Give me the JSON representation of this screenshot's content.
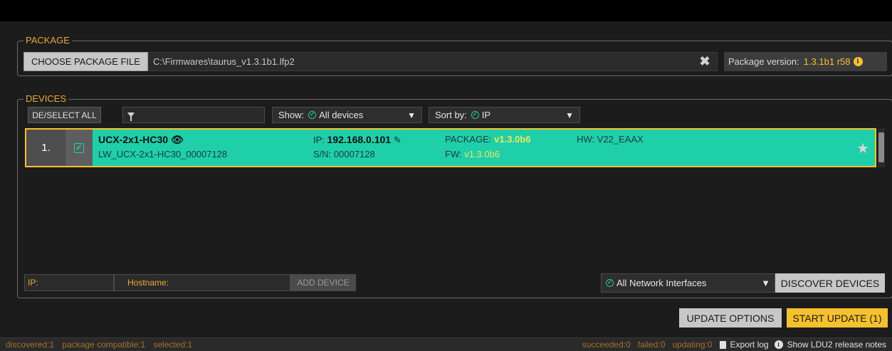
{
  "package": {
    "legend": "PACKAGE",
    "choose_label": "CHOOSE PACKAGE FILE",
    "path_value": "C:\\Firmwares\\taurus_v1.3.1b1.lfp2",
    "clear_icon": "close-icon",
    "version_label": "Package version:",
    "version_value": "1.3.1b1 r58",
    "info_icon": "info-icon"
  },
  "devices": {
    "legend": "DEVICES",
    "deselect_label": "DE/SELECT ALL",
    "filter_icon": "filter-icon",
    "filter_value": "",
    "show_label": "Show:",
    "show_value": "All devices",
    "sort_label": "Sort by:",
    "sort_value": "IP",
    "rows": [
      {
        "index": "1.",
        "name": "UCX-2x1-HC30",
        "hostname": "LW_UCX-2x1-HC30_00007128",
        "ip_label": "IP:",
        "ip_value": "192.168.0.101",
        "sn": "S/N: 00007128",
        "package_label": "PACKAGE:",
        "package_value": "v1.3.0b6",
        "fw_label": "FW:",
        "fw_value": "v1.3.0b6",
        "hw": "HW: V22_EAAX",
        "selected": true,
        "favorite_icon": "star-icon"
      }
    ],
    "ip_placeholder": "IP:",
    "hostname_placeholder": "Hostname:",
    "add_label": "ADD DEVICE",
    "network_value": "All Network Interfaces",
    "discover_label": "DISCOVER DEVICES"
  },
  "actions": {
    "options_label": "UPDATE OPTIONS",
    "start_label": "START UPDATE (1)"
  },
  "status": {
    "discovered": "discovered:1",
    "compatible": "package compatible:1",
    "selected": "selected:1",
    "succeeded": "succeeded:0",
    "failed": "failed:0",
    "updating": "updating:0",
    "export_label": "Export log",
    "notes_label": "Show LDU2 release notes"
  },
  "colors": {
    "accent": "#f5c12e",
    "row_bg": "#1fcfa9",
    "legend": "#e8a838"
  }
}
